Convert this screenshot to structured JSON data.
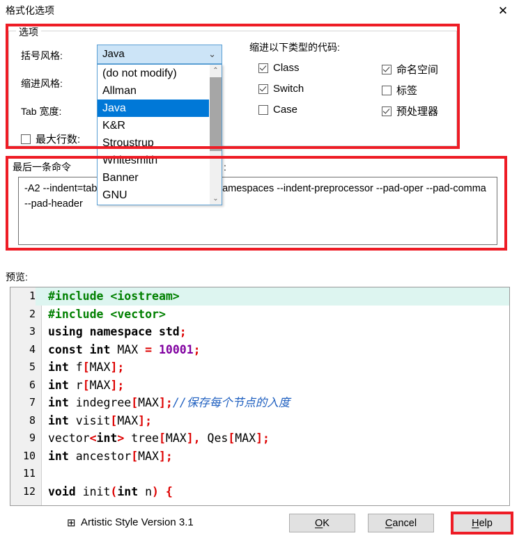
{
  "window": {
    "title": "格式化选项",
    "close_icon": "close-icon",
    "close_glyph": "✕"
  },
  "options_group": {
    "legend": "选项",
    "labels": {
      "brace_style": "括号风格:",
      "indent_style": "缩进风格:",
      "tab_width": "Tab 宽度:",
      "max_lines": "最大行数:"
    },
    "max_lines_checked": false,
    "brace_combo": {
      "selected": "Java",
      "arrow_glyph": "⌄",
      "options": [
        "(do not modify)",
        "Allman",
        "Java",
        "K&R",
        "Stroustrup",
        "Whitesmith",
        "Banner",
        "GNU"
      ],
      "selected_index": 2,
      "scroll_up_glyph": "⌃",
      "scroll_down_glyph": "⌄"
    }
  },
  "indent_panel": {
    "title": "缩进以下类型的代码:",
    "left_items": [
      {
        "label": "Class",
        "checked": true
      },
      {
        "label": "Switch",
        "checked": true
      },
      {
        "label": "Case",
        "checked": false
      }
    ],
    "right_items": [
      {
        "label": "命名空间",
        "checked": true
      },
      {
        "label": "标签",
        "checked": false
      },
      {
        "label": "预处理器",
        "checked": true
      }
    ]
  },
  "command_section": {
    "label_left": "最后一条命令",
    "label_right": "置）:",
    "command": "-A2 --indent=tab --indent-switches --indent-namespaces --indent-preprocessor --pad-oper --pad-comma --pad-header"
  },
  "preview": {
    "label": "预览:",
    "lines": [
      {
        "n": "1",
        "highlight": true,
        "tokens": [
          {
            "t": "pre",
            "s": "#include <iostream>"
          }
        ]
      },
      {
        "n": "2",
        "highlight": false,
        "tokens": [
          {
            "t": "pre",
            "s": "#include <vector>"
          }
        ]
      },
      {
        "n": "3",
        "highlight": false,
        "tokens": [
          {
            "t": "kw",
            "s": "using namespace std"
          },
          {
            "t": "pun",
            "s": ";"
          }
        ]
      },
      {
        "n": "4",
        "highlight": false,
        "tokens": [
          {
            "t": "kw",
            "s": "const int"
          },
          {
            "t": "pln",
            "s": " MAX "
          },
          {
            "t": "op",
            "s": "="
          },
          {
            "t": "pln",
            "s": " "
          },
          {
            "t": "num",
            "s": "10001"
          },
          {
            "t": "pun",
            "s": ";"
          }
        ]
      },
      {
        "n": "5",
        "highlight": false,
        "tokens": [
          {
            "t": "kw",
            "s": "int"
          },
          {
            "t": "pln",
            "s": " f"
          },
          {
            "t": "pun",
            "s": "["
          },
          {
            "t": "pln",
            "s": "MAX"
          },
          {
            "t": "pun",
            "s": "];"
          }
        ]
      },
      {
        "n": "6",
        "highlight": false,
        "tokens": [
          {
            "t": "kw",
            "s": "int"
          },
          {
            "t": "pln",
            "s": " r"
          },
          {
            "t": "pun",
            "s": "["
          },
          {
            "t": "pln",
            "s": "MAX"
          },
          {
            "t": "pun",
            "s": "];"
          }
        ]
      },
      {
        "n": "7",
        "highlight": false,
        "tokens": [
          {
            "t": "kw",
            "s": "int"
          },
          {
            "t": "pln",
            "s": " indegree"
          },
          {
            "t": "pun",
            "s": "["
          },
          {
            "t": "pln",
            "s": "MAX"
          },
          {
            "t": "pun",
            "s": "];"
          },
          {
            "t": "cmt",
            "s": "//保存每个节点的入度"
          }
        ]
      },
      {
        "n": "8",
        "highlight": false,
        "tokens": [
          {
            "t": "kw",
            "s": "int"
          },
          {
            "t": "pln",
            "s": " visit"
          },
          {
            "t": "pun",
            "s": "["
          },
          {
            "t": "pln",
            "s": "MAX"
          },
          {
            "t": "pun",
            "s": "];"
          }
        ]
      },
      {
        "n": "9",
        "highlight": false,
        "tokens": [
          {
            "t": "pln",
            "s": "vector"
          },
          {
            "t": "pun",
            "s": "<"
          },
          {
            "t": "kw",
            "s": "int"
          },
          {
            "t": "pun",
            "s": ">"
          },
          {
            "t": "pln",
            "s": " tree"
          },
          {
            "t": "pun",
            "s": "["
          },
          {
            "t": "pln",
            "s": "MAX"
          },
          {
            "t": "pun",
            "s": "],"
          },
          {
            "t": "pln",
            "s": " Qes"
          },
          {
            "t": "pun",
            "s": "["
          },
          {
            "t": "pln",
            "s": "MAX"
          },
          {
            "t": "pun",
            "s": "];"
          }
        ]
      },
      {
        "n": "10",
        "highlight": false,
        "tokens": [
          {
            "t": "kw",
            "s": "int"
          },
          {
            "t": "pln",
            "s": " ancestor"
          },
          {
            "t": "pun",
            "s": "["
          },
          {
            "t": "pln",
            "s": "MAX"
          },
          {
            "t": "pun",
            "s": "];"
          }
        ]
      },
      {
        "n": "11",
        "highlight": false,
        "tokens": []
      },
      {
        "n": "12",
        "highlight": false,
        "tokens": [
          {
            "t": "kw",
            "s": "void"
          },
          {
            "t": "pln",
            "s": " init"
          },
          {
            "t": "pun",
            "s": "("
          },
          {
            "t": "kw",
            "s": "int"
          },
          {
            "t": "pln",
            "s": " n"
          },
          {
            "t": "pun",
            "s": ")"
          },
          {
            "t": "pln",
            "s": " "
          },
          {
            "t": "pun",
            "s": "{"
          }
        ]
      }
    ]
  },
  "footer": {
    "app_icon": "application-icon",
    "app_icon_glyph": "⊞",
    "version_text": "Artistic Style Version 3.1",
    "buttons": [
      {
        "name": "ok",
        "mnemonic": "O",
        "rest": "K"
      },
      {
        "name": "cancel",
        "mnemonic": "C",
        "rest": "ancel"
      },
      {
        "name": "help",
        "mnemonic": "H",
        "rest": "elp"
      }
    ]
  }
}
